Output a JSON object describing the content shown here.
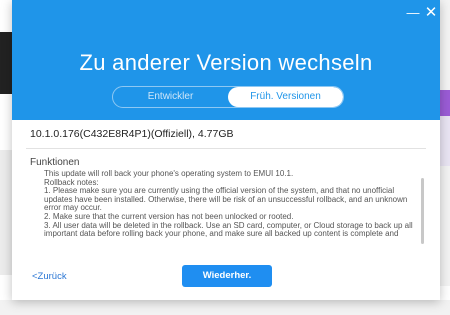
{
  "window": {
    "minimize_glyph": "—",
    "close_glyph": "✕"
  },
  "dialog": {
    "title": "Zu anderer Version wechseln",
    "tabs": [
      {
        "label": "Entwickler",
        "active": false
      },
      {
        "label": "Früh. Versionen",
        "active": true
      }
    ],
    "version": "10.1.0.176(C432E8R4P1)(Offiziell), 4.77GB",
    "section_title": "Funktionen",
    "notes": [
      "This update will roll back your phone's operating system to EMUI 10.1.",
      "Rollback notes:",
      "1. Please make sure you are currently using the official version of the system, and that no unofficial updates have been installed. Otherwise, there will be risk of an unsuccessful rollback, and an unknown error may occur.",
      "2. Make sure that the current version has not been unlocked or rooted.",
      "3. All user data will be deleted in the rollback. Use an SD card, computer, or Cloud storage to back up all important data before rolling back your phone, and make sure all backed up content is complete and"
    ],
    "back_label": "<Zurück",
    "restore_label": "Wiederher."
  },
  "colors": {
    "header_blue": "#1f95e9",
    "button_blue": "#1f8ef1",
    "link_blue": "#2a76d4"
  }
}
